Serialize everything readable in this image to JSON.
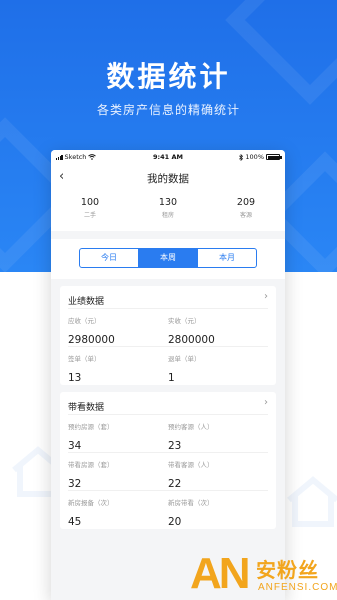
{
  "hero": {
    "title": "数据统计",
    "subtitle": "各类房产信息的精确统计"
  },
  "status_bar": {
    "carrier": "Sketch",
    "time": "9:41 AM",
    "battery": "100%",
    "battery_level": 1.0
  },
  "navbar": {
    "back_icon": "chevron-left-icon",
    "title": "我的数据"
  },
  "summary": [
    {
      "value": "100",
      "label": "二手"
    },
    {
      "value": "130",
      "label": "租房"
    },
    {
      "value": "209",
      "label": "客源"
    }
  ],
  "tabs": {
    "items": [
      "今日",
      "本周",
      "本月"
    ],
    "selected": "本周"
  },
  "performance": {
    "title": "业绩数据",
    "items": [
      {
        "label": "应收（元）",
        "value": "2980000"
      },
      {
        "label": "实收（元）",
        "value": "2800000"
      },
      {
        "label": "签单（单）",
        "value": "13"
      },
      {
        "label": "退单（单）",
        "value": "1"
      }
    ]
  },
  "viewing": {
    "title": "带看数据",
    "items": [
      {
        "label": "预约房源（套）",
        "value": "34"
      },
      {
        "label": "预约客源（人）",
        "value": "23"
      },
      {
        "label": "带看房源（套）",
        "value": "32"
      },
      {
        "label": "带看客源（人）",
        "value": "22"
      },
      {
        "label": "新房报备（次）",
        "value": "45"
      },
      {
        "label": "新房带看（次）",
        "value": "20"
      }
    ]
  },
  "watermark": {
    "logo": "AN",
    "name": "安粉丝",
    "domain": "ANFENSI.COM"
  },
  "colors": {
    "brand_blue": "#2a7cf0",
    "hero_blue": "#1f6fe8",
    "watermark_orange": "#f2a51d"
  }
}
